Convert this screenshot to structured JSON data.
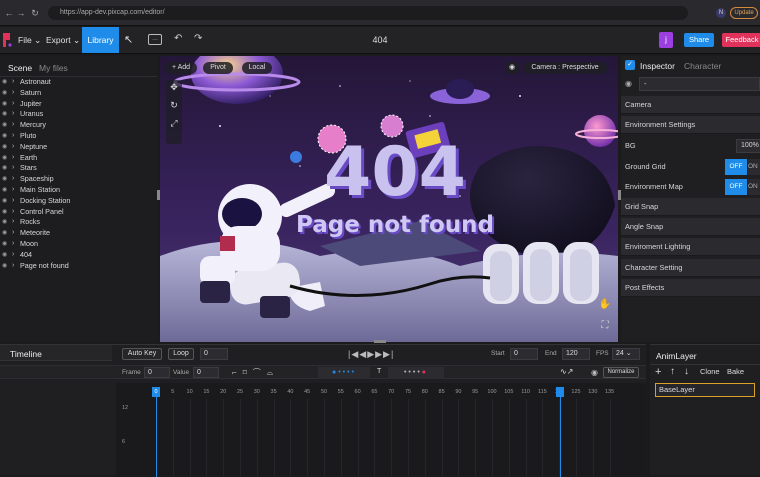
{
  "browser": {
    "url": "https://app-dev.pixcap.com/editor/",
    "update_label": "Update",
    "profile_initial": "N"
  },
  "toolbar": {
    "file_label": "File",
    "export_label": "Export",
    "library_label": "Library",
    "project_title": "404",
    "user_initial": "j",
    "share_label": "Share",
    "feedback_label": "Feedback"
  },
  "scene_panel": {
    "tab_scene": "Scene",
    "tab_myfiles": "My files",
    "items": [
      {
        "label": "Astronaut"
      },
      {
        "label": "Saturn"
      },
      {
        "label": "Jupiter"
      },
      {
        "label": "Uranus"
      },
      {
        "label": "Mercury"
      },
      {
        "label": "Pluto"
      },
      {
        "label": "Neptune"
      },
      {
        "label": "Earth"
      },
      {
        "label": "Stars"
      },
      {
        "label": "Spaceship"
      },
      {
        "label": "Main Station"
      },
      {
        "label": "Docking Station"
      },
      {
        "label": "Control Panel"
      },
      {
        "label": "Rocks"
      },
      {
        "label": "Meteorite"
      },
      {
        "label": "Moon"
      },
      {
        "label": "404"
      },
      {
        "label": "Page not found"
      }
    ]
  },
  "viewport": {
    "add_label": "+ Add",
    "pivot_label": "Pivot",
    "local_label": "Local",
    "camera_label": "Camera : Prespective",
    "scene_text_big": "404",
    "scene_text_sub": "Page not found"
  },
  "inspector": {
    "tab_inspector": "Inspector",
    "tab_character": "Character",
    "dropdown_value": "-",
    "rows": {
      "camera": "Camera",
      "env_settings": "Environment Settings",
      "bg": "BG",
      "bg_value": "100%",
      "ground_grid": "Ground Grid",
      "env_map": "Environment Map",
      "off": "OFF",
      "on": "ON",
      "grid_snap": "Grid Snap",
      "angle_snap": "Angle Snap",
      "env_lighting": "Enviroment Lighting",
      "character_setting": "Character Setting",
      "post_effects": "Post Effects"
    }
  },
  "timeline": {
    "tab_label": "Timeline",
    "auto_key": "Auto Key",
    "loop": "Loop",
    "frame_value": "0",
    "start_label": "Start",
    "start_value": "0",
    "end_label": "End",
    "end_value": "120",
    "fps_label": "FPS",
    "fps_value": "24",
    "frame_label": "Frame",
    "frame_field": "0",
    "value_label": "Value",
    "value_field": "0",
    "normalize": "Normalize",
    "t_label": "T",
    "current_frame": "0",
    "ticks": [
      "5",
      "10",
      "15",
      "20",
      "25",
      "30",
      "35",
      "40",
      "45",
      "50",
      "55",
      "60",
      "65",
      "70",
      "75",
      "80",
      "85",
      "90",
      "95",
      "100",
      "105",
      "110",
      "115",
      "120",
      "125",
      "130",
      "135"
    ],
    "y_labels": [
      "12",
      "6"
    ]
  },
  "anim_layer": {
    "tab_label": "AnimLayer",
    "clone": "Clone",
    "bake": "Bake",
    "base_layer": "BaseLayer"
  }
}
